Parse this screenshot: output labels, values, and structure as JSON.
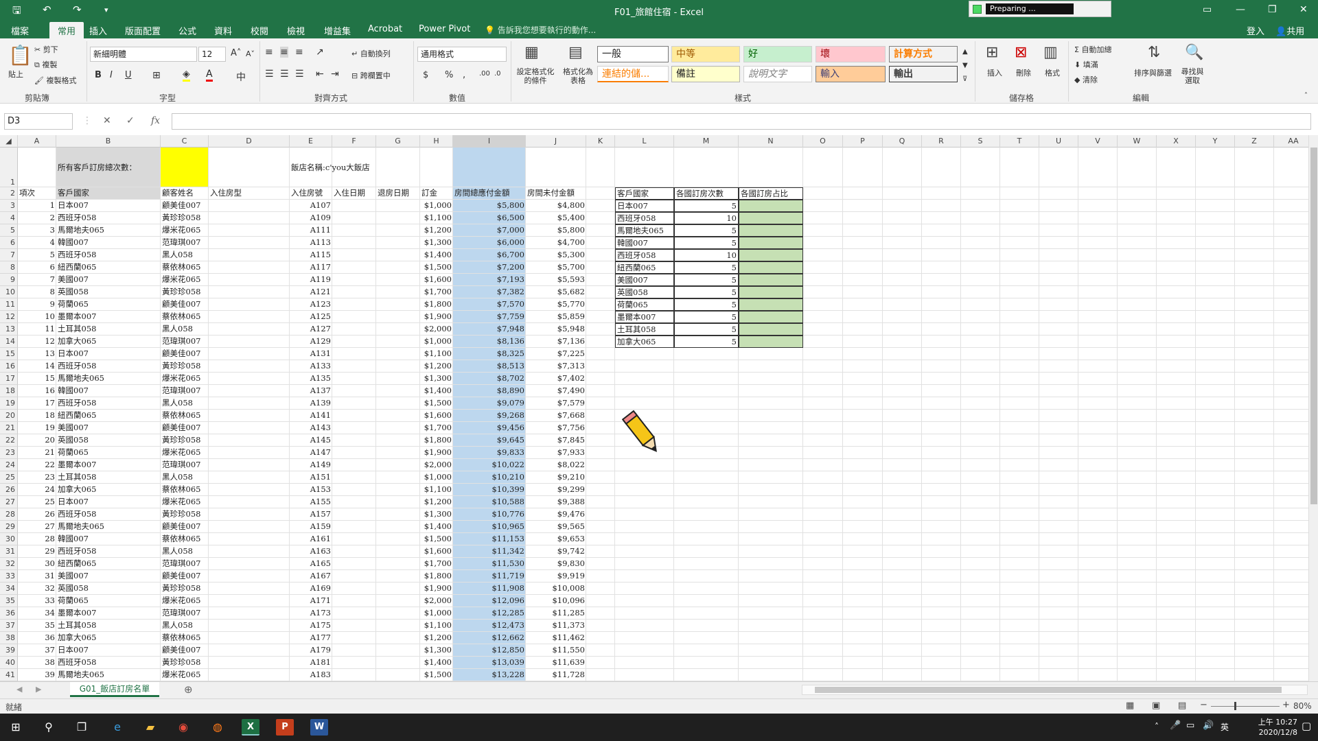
{
  "titlebar": {
    "title": "F01_旅館住宿 - Excel",
    "preparing": "Preparing ..."
  },
  "tabs": [
    "檔案",
    "常用",
    "插入",
    "版面配置",
    "公式",
    "資料",
    "校閱",
    "檢視",
    "增益集",
    "Acrobat",
    "Power Pivot"
  ],
  "tell_me": "告訴我您想要執行的動作...",
  "signin": "登入",
  "share": "共用",
  "ribbon": {
    "paste": "貼上",
    "cut": "剪下",
    "copy": "複製",
    "format_painter": "複製格式",
    "font_name": "新細明體",
    "font_size": "12",
    "wrap": "自動換列",
    "merge": "跨欄置中",
    "number_format": "通用格式",
    "cond_format": "設定格式化的條件",
    "table_format": "格式化為表格",
    "styles": {
      "normal": "一般",
      "neutral": "中等",
      "good": "好",
      "bad": "壞",
      "calc": "計算方式",
      "linked": "連結的儲...",
      "note": "備註",
      "explanatory": "說明文字",
      "input": "輸入",
      "output": "輸出"
    },
    "insert": "插入",
    "delete": "刪除",
    "format": "格式",
    "autosum": "自動加總",
    "fill": "填滿",
    "clear": "清除",
    "sort": "排序與篩選",
    "find": "尋找與選取",
    "groups": {
      "clipboard": "剪貼簿",
      "font": "字型",
      "alignment": "對齊方式",
      "number": "數值",
      "styles": "樣式",
      "cells": "儲存格",
      "editing": "編輯"
    }
  },
  "namebox": "D3",
  "columns": [
    {
      "l": "A",
      "w": 56
    },
    {
      "l": "B",
      "w": 152
    },
    {
      "l": "C",
      "w": 70
    },
    {
      "l": "D",
      "w": 118
    },
    {
      "l": "E",
      "w": 62
    },
    {
      "l": "F",
      "w": 64
    },
    {
      "l": "G",
      "w": 64
    },
    {
      "l": "H",
      "w": 48
    },
    {
      "l": "I",
      "w": 106
    },
    {
      "l": "J",
      "w": 88
    },
    {
      "l": "K",
      "w": 42
    },
    {
      "l": "L",
      "w": 86
    },
    {
      "l": "M",
      "w": 94
    },
    {
      "l": "N",
      "w": 94
    },
    {
      "l": "O",
      "w": 58
    },
    {
      "l": "P",
      "w": 58
    },
    {
      "l": "Q",
      "w": 57
    },
    {
      "l": "R",
      "w": 57
    },
    {
      "l": "S",
      "w": 57
    },
    {
      "l": "T",
      "w": 57
    },
    {
      "l": "U",
      "w": 57
    },
    {
      "l": "V",
      "w": 57
    },
    {
      "l": "W",
      "w": 57
    },
    {
      "l": "X",
      "w": 57
    },
    {
      "l": "Y",
      "w": 57
    },
    {
      "l": "Z",
      "w": 57
    },
    {
      "l": "AA",
      "w": 57
    }
  ],
  "row1": {
    "label": "所有客戶訂房總次數：",
    "hotel": "飯店名稱:c'you大飯店"
  },
  "headers": [
    "項次",
    "客戶國家",
    "顧客姓名",
    "入住房型",
    "入住房號",
    "入住日期",
    "退房日期",
    "訂金",
    "房間總應付金額",
    "房間未付金額"
  ],
  "rows": [
    [
      "1",
      "日本007",
      "顧美佳007",
      "A107",
      "$1,000",
      "$5,800",
      "$4,800"
    ],
    [
      "2",
      "西班牙058",
      "黃珍珍058",
      "A109",
      "$1,100",
      "$6,500",
      "$5,400"
    ],
    [
      "3",
      "馬爾地夫065",
      "爆米花065",
      "A111",
      "$1,200",
      "$7,000",
      "$5,800"
    ],
    [
      "4",
      "韓國007",
      "范瑋琪007",
      "A113",
      "$1,300",
      "$6,000",
      "$4,700"
    ],
    [
      "5",
      "西班牙058",
      "黑人058",
      "A115",
      "$1,400",
      "$6,700",
      "$5,300"
    ],
    [
      "6",
      "紐西蘭065",
      "蔡依林065",
      "A117",
      "$1,500",
      "$7,200",
      "$5,700"
    ],
    [
      "7",
      "美國007",
      "爆米花065",
      "A119",
      "$1,600",
      "$7,193",
      "$5,593"
    ],
    [
      "8",
      "英國058",
      "黃珍珍058",
      "A121",
      "$1,700",
      "$7,382",
      "$5,682"
    ],
    [
      "9",
      "荷蘭065",
      "顧美佳007",
      "A123",
      "$1,800",
      "$7,570",
      "$5,770"
    ],
    [
      "10",
      "墨爾本007",
      "蔡依林065",
      "A125",
      "$1,900",
      "$7,759",
      "$5,859"
    ],
    [
      "11",
      "土耳其058",
      "黑人058",
      "A127",
      "$2,000",
      "$7,948",
      "$5,948"
    ],
    [
      "12",
      "加拿大065",
      "范瑋琪007",
      "A129",
      "$1,000",
      "$8,136",
      "$7,136"
    ],
    [
      "13",
      "日本007",
      "顧美佳007",
      "A131",
      "$1,100",
      "$8,325",
      "$7,225"
    ],
    [
      "14",
      "西班牙058",
      "黃珍珍058",
      "A133",
      "$1,200",
      "$8,513",
      "$7,313"
    ],
    [
      "15",
      "馬爾地夫065",
      "爆米花065",
      "A135",
      "$1,300",
      "$8,702",
      "$7,402"
    ],
    [
      "16",
      "韓國007",
      "范瑋琪007",
      "A137",
      "$1,400",
      "$8,890",
      "$7,490"
    ],
    [
      "17",
      "西班牙058",
      "黑人058",
      "A139",
      "$1,500",
      "$9,079",
      "$7,579"
    ],
    [
      "18",
      "紐西蘭065",
      "蔡依林065",
      "A141",
      "$1,600",
      "$9,268",
      "$7,668"
    ],
    [
      "19",
      "美國007",
      "顧美佳007",
      "A143",
      "$1,700",
      "$9,456",
      "$7,756"
    ],
    [
      "20",
      "英國058",
      "黃珍珍058",
      "A145",
      "$1,800",
      "$9,645",
      "$7,845"
    ],
    [
      "21",
      "荷蘭065",
      "爆米花065",
      "A147",
      "$1,900",
      "$9,833",
      "$7,933"
    ],
    [
      "22",
      "墨爾本007",
      "范瑋琪007",
      "A149",
      "$2,000",
      "$10,022",
      "$8,022"
    ],
    [
      "23",
      "土耳其058",
      "黑人058",
      "A151",
      "$1,000",
      "$10,210",
      "$9,210"
    ],
    [
      "24",
      "加拿大065",
      "蔡依林065",
      "A153",
      "$1,100",
      "$10,399",
      "$9,299"
    ],
    [
      "25",
      "日本007",
      "爆米花065",
      "A155",
      "$1,200",
      "$10,588",
      "$9,388"
    ],
    [
      "26",
      "西班牙058",
      "黃珍珍058",
      "A157",
      "$1,300",
      "$10,776",
      "$9,476"
    ],
    [
      "27",
      "馬爾地夫065",
      "顧美佳007",
      "A159",
      "$1,400",
      "$10,965",
      "$9,565"
    ],
    [
      "28",
      "韓國007",
      "蔡依林065",
      "A161",
      "$1,500",
      "$11,153",
      "$9,653"
    ],
    [
      "29",
      "西班牙058",
      "黑人058",
      "A163",
      "$1,600",
      "$11,342",
      "$9,742"
    ],
    [
      "30",
      "紐西蘭065",
      "范瑋琪007",
      "A165",
      "$1,700",
      "$11,530",
      "$9,830"
    ],
    [
      "31",
      "美國007",
      "顧美佳007",
      "A167",
      "$1,800",
      "$11,719",
      "$9,919"
    ],
    [
      "32",
      "英國058",
      "黃珍珍058",
      "A169",
      "$1,900",
      "$11,908",
      "$10,008"
    ],
    [
      "33",
      "荷蘭065",
      "爆米花065",
      "A171",
      "$2,000",
      "$12,096",
      "$10,096"
    ],
    [
      "34",
      "墨爾本007",
      "范瑋琪007",
      "A173",
      "$1,000",
      "$12,285",
      "$11,285"
    ],
    [
      "35",
      "土耳其058",
      "黑人058",
      "A175",
      "$1,100",
      "$12,473",
      "$11,373"
    ],
    [
      "36",
      "加拿大065",
      "蔡依林065",
      "A177",
      "$1,200",
      "$12,662",
      "$11,462"
    ],
    [
      "37",
      "日本007",
      "顧美佳007",
      "A179",
      "$1,300",
      "$12,850",
      "$11,550"
    ],
    [
      "38",
      "西班牙058",
      "黃珍珍058",
      "A181",
      "$1,400",
      "$13,039",
      "$11,639"
    ],
    [
      "39",
      "馬爾地夫065",
      "爆米花065",
      "A183",
      "$1,500",
      "$13,228",
      "$11,728"
    ]
  ],
  "summary": {
    "headers": [
      "客戶國家",
      "各國訂房次數",
      "各國訂房占比"
    ],
    "rows": [
      [
        "日本007",
        "5"
      ],
      [
        "西班牙058",
        "10"
      ],
      [
        "馬爾地夫065",
        "5"
      ],
      [
        "韓國007",
        "5"
      ],
      [
        "西班牙058",
        "10"
      ],
      [
        "紐西蘭065",
        "5"
      ],
      [
        "美國007",
        "5"
      ],
      [
        "英國058",
        "5"
      ],
      [
        "荷蘭065",
        "5"
      ],
      [
        "墨爾本007",
        "5"
      ],
      [
        "土耳其058",
        "5"
      ],
      [
        "加拿大065",
        "5"
      ]
    ]
  },
  "sheet_tab": "G01_飯店訂房名單",
  "status": {
    "ready": "就緒",
    "zoom": "80%"
  },
  "taskbar": {
    "time": "上午 10:27",
    "date": "2020/12/8",
    "ime": "英"
  }
}
